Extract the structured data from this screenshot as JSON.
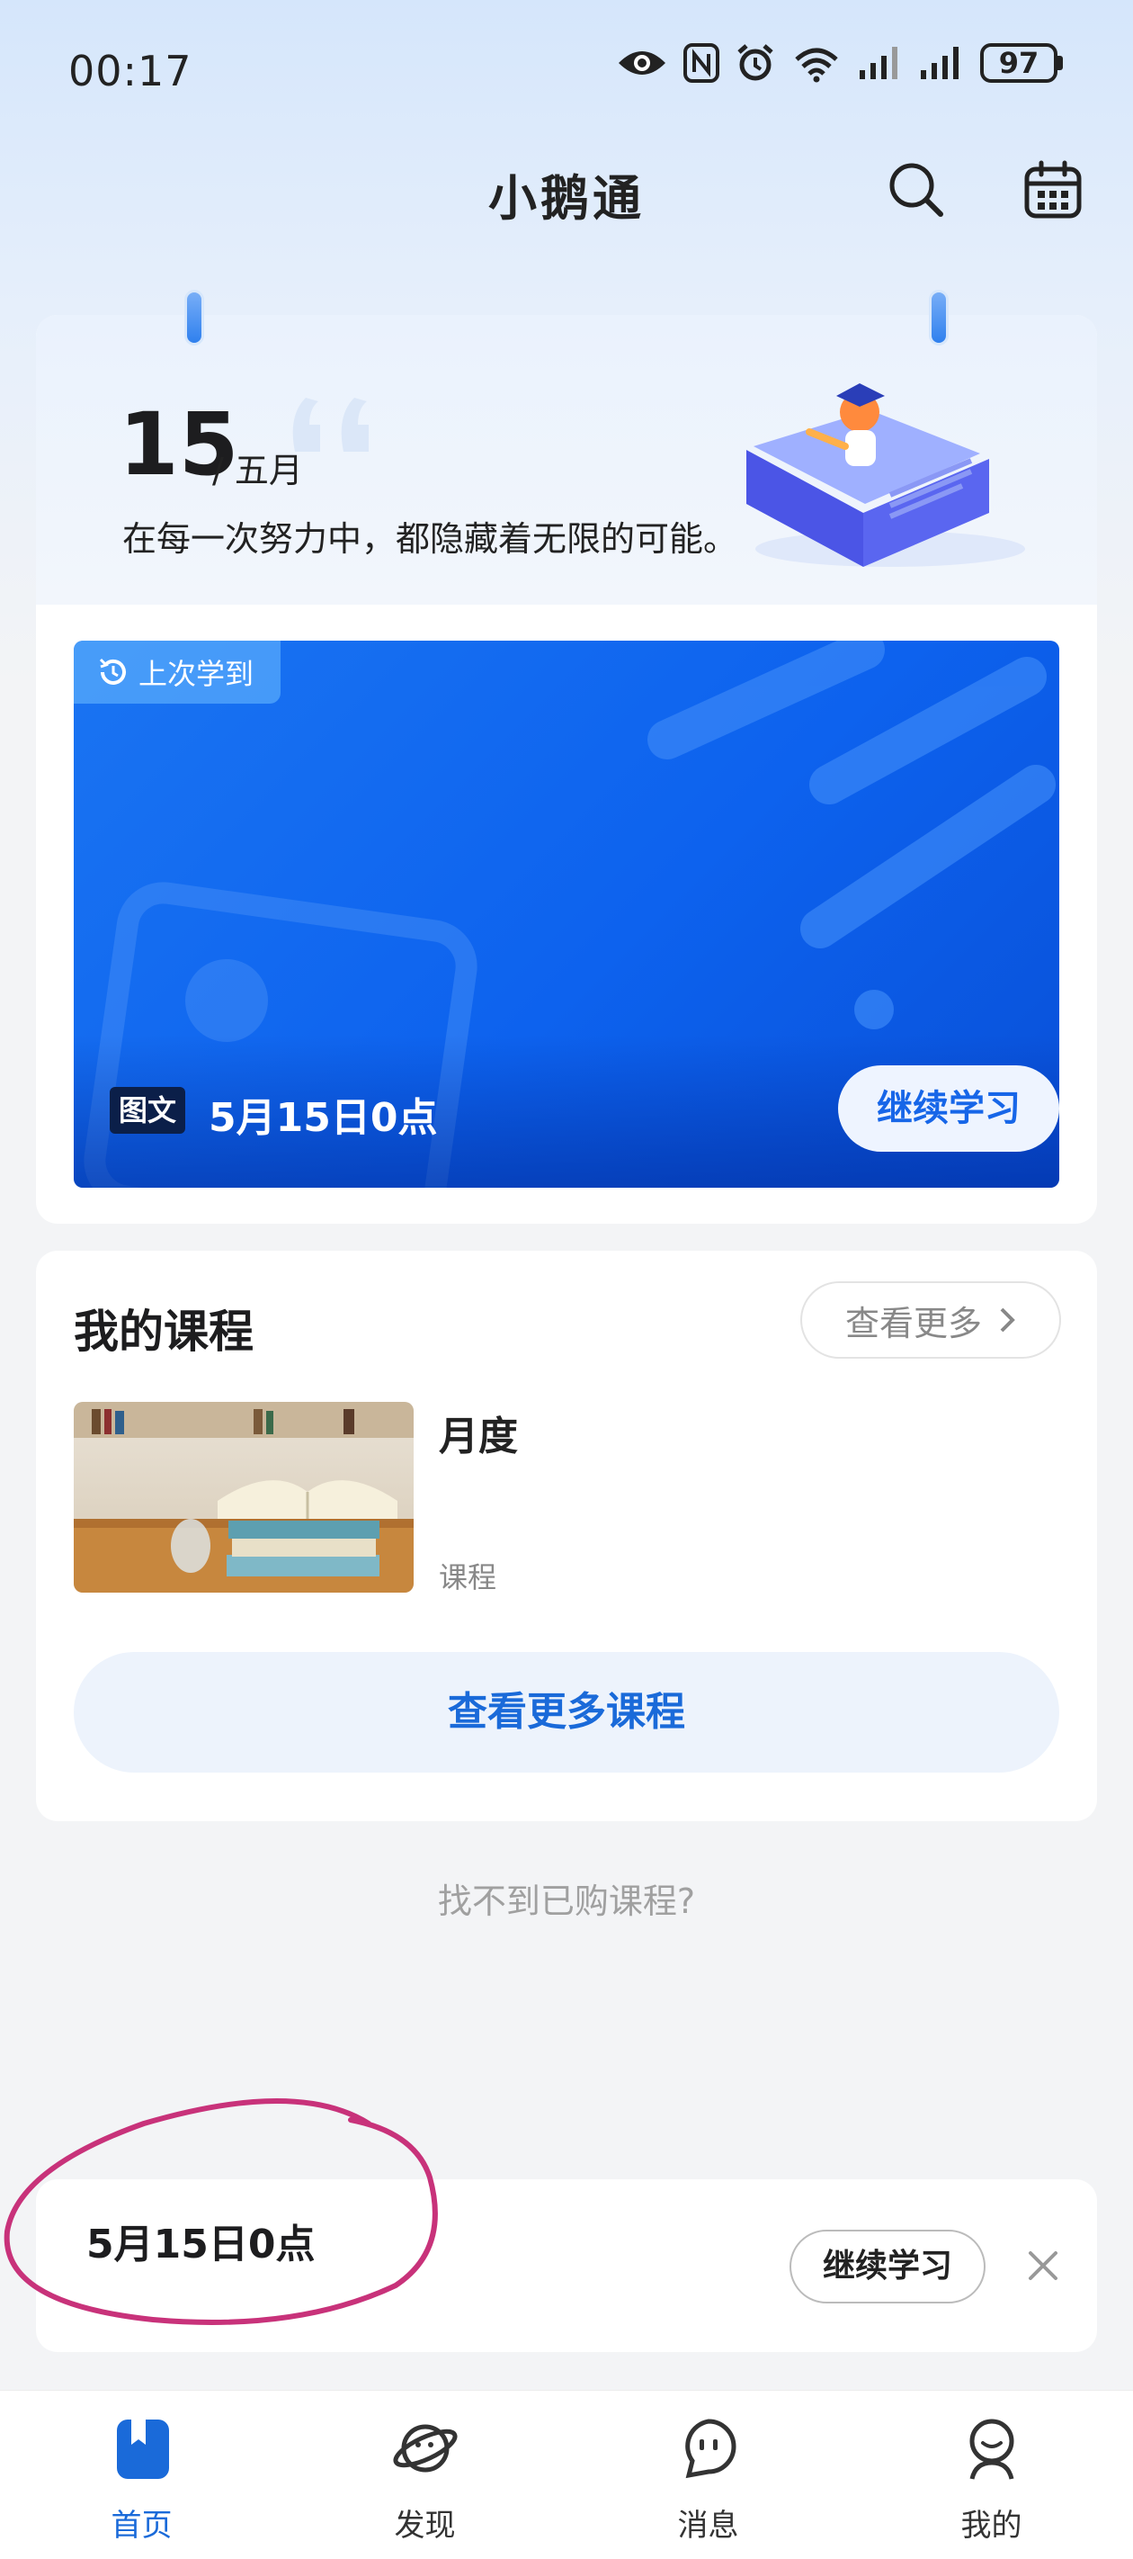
{
  "status_bar": {
    "time": "00:17",
    "battery": "97",
    "icons": [
      "eye-icon",
      "nfc-icon",
      "alarm-icon",
      "wifi-icon",
      "signal-icon",
      "signal-icon",
      "battery-icon"
    ]
  },
  "header": {
    "title": "小鹅通",
    "icons": [
      "search-icon",
      "calendar-icon"
    ]
  },
  "date_card": {
    "day": "15",
    "month": "/ 五月",
    "quote": "在每一次努力中，都隐藏着无限的可能。"
  },
  "last_learned": {
    "badge": "上次学到",
    "type_tag": "图文",
    "title": "5月15日0点",
    "continue_label": "继续学习"
  },
  "my_courses": {
    "title": "我的课程",
    "more_label": "查看更多",
    "course": {
      "name": "月度",
      "type": "课程"
    },
    "more_courses_label": "查看更多课程"
  },
  "cant_find_label": "找不到已购课程?",
  "resume_bar": {
    "title": "5月15日0点",
    "continue_label": "继续学习"
  },
  "bottom_nav": {
    "items": [
      {
        "label": "首页",
        "icon": "book-icon",
        "active": true
      },
      {
        "label": "发现",
        "icon": "planet-icon",
        "active": false
      },
      {
        "label": "消息",
        "icon": "message-icon",
        "active": false
      },
      {
        "label": "我的",
        "icon": "profile-icon",
        "active": false
      }
    ]
  },
  "colors": {
    "accent": "#1a6ad9",
    "banner_blue": "#0d62ee",
    "annotation": "#c8327a"
  }
}
